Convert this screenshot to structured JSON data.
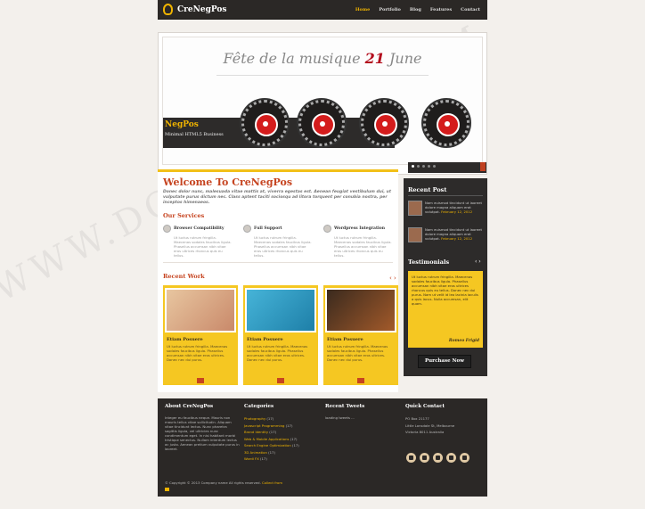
{
  "header": {
    "logo_text": "CreNegPos",
    "nav": [
      "Home",
      "Portfolio",
      "Blog",
      "Features",
      "Contact"
    ]
  },
  "slider": {
    "title_pre": "Fête de la musique ",
    "title_hl": "21",
    "title_post": " June",
    "caption_name": "NegPos",
    "caption_tag": "Minimal HTML5 Business"
  },
  "main": {
    "welcome_title": "Welcome To CreNegPos",
    "intro": "Donec dolor nunc, malesuada vitae mattis at, viverra egestas est. Aenean feugiat vestibulum dui, ut vulputate purus dictum nec. Class aptent taciti sociosqu ad litora torquent per conubia nostra, per inceptos himenaeos.",
    "services_title": "Our Services",
    "services": [
      {
        "title": "Browser Compatibility",
        "text": "Ut luctus rutrum fringilla. Maecenas sodales faucibus ligula. Phasellus accumsan nibh vitae eros ultrices rhoncus quis eu tellus."
      },
      {
        "title": "Full Support",
        "text": "Ut luctus rutrum fringilla. Maecenas sodales faucibus ligula. Phasellus accumsan nibh vitae eros ultrices rhoncus quis eu tellus."
      },
      {
        "title": "Wordpress Integration",
        "text": "Ut luctus rutrum fringilla. Maecenas sodales faucibus ligula. Phasellus accumsan nibh vitae eros ultrices rhoncus quis eu tellus."
      }
    ],
    "work_title": "Recent Work",
    "work": [
      {
        "title": "Etiam Posuere",
        "text": "Ut luctus rutrum fringilla. Maecenas sodales faucibus ligula. Phasellus accumsan nibh vitae eros ultrices. Donec nec dui purus."
      },
      {
        "title": "Etiam Posuere",
        "text": "Ut luctus rutrum fringilla. Maecenas sodales faucibus ligula. Phasellus accumsan nibh vitae eros ultrices. Donec nec dui purus."
      },
      {
        "title": "Etiam Posuere",
        "text": "Ut luctus rutrum fringilla. Maecenas sodales faucibus ligula. Phasellus accumsan nibh vitae eros ultrices. Donec nec dui purus."
      }
    ]
  },
  "sidebar": {
    "recent_post_title": "Recent Post",
    "posts": [
      {
        "text": "Nam euismod tincidunt ut laoreet dolore magna aliquam erat volutpat.",
        "date": "February 12, 2012"
      },
      {
        "text": "Nam euismod tincidunt ut laoreet dolore magna aliquam erat volutpat.",
        "date": "February 12, 2012"
      }
    ],
    "testimonials_title": "Testimonials",
    "testimonial_text": "Ut luctus rutrum fringilla. Maecenas sodales faucibus ligula. Phasellus accumsan nibh vitae eros ultrices rhoncus quis eu tellus. Donec nec dui purus. Nam ut velit id leo lacinia iaculis a quis lacus. Nulla accumsan, elit quam.",
    "testimonial_author": "Romeo Frigid",
    "purchase_label": "Purchase Now"
  },
  "footer": {
    "about_title": "About CreNegPos",
    "about_text": "Integer eu faucibus neque. Mauris non mauris tellus vitae sollicitudin. Aliquam vitae tincidunt lectus. Nunc pharetra sagittis ligula, vel ultricies nunc condimentum eget. In nisi habitant morbi tristique senectus. Nullam interdum lectus ac justo. Aenean pretium vulputate purus in laoreet.",
    "categories_title": "Categories",
    "categories": [
      {
        "name": "Photography",
        "count": "(17)"
      },
      {
        "name": "Javascript Programming",
        "count": "(17)"
      },
      {
        "name": "Brand Identity",
        "count": "(17)"
      },
      {
        "name": "Web & Mobile Applications",
        "count": "(17)"
      },
      {
        "name": "Search Engine Optimization",
        "count": "(17)"
      },
      {
        "name": "3D Animation",
        "count": "(17)"
      },
      {
        "name": "Wordi FX",
        "count": "(17)"
      }
    ],
    "tweets_title": "Recent Tweets",
    "tweets_text": "loading tweets ...",
    "contact_title": "Quick Contact",
    "contact_lines": [
      "PO Box 21177",
      "Little Lonsdale St, Melbourne",
      "Victoria 8011 Australia"
    ],
    "copyright": "© Copyright © 2013 Company name All rights reserved.",
    "copyright_link": "Collect from"
  },
  "watermark": "WWW.DOWNDEMO.COM",
  "colors": {
    "accent": "#f0b400",
    "brand_red": "#c64420",
    "dark": "#2b2826",
    "card_yellow": "#f5c722"
  }
}
